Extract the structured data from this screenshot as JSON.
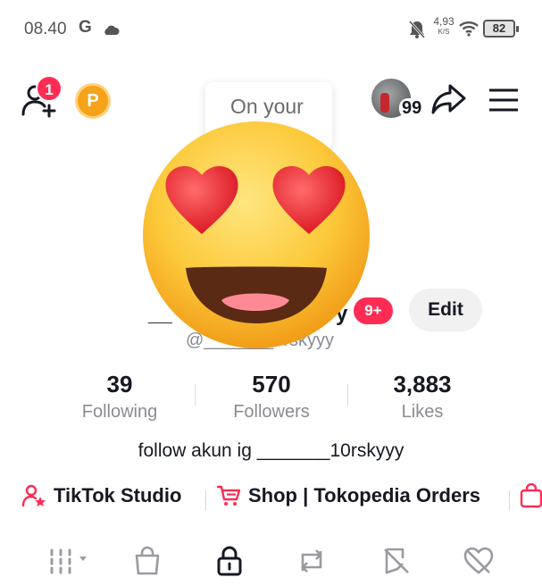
{
  "status_bar": {
    "time": "08.40",
    "carrier_glyph": "G",
    "icons": [
      "cloud-icon",
      "bell-muted-icon",
      "wifi-icon",
      "battery-icon"
    ],
    "net_speed": "4,93",
    "net_speed_unit": "K/S",
    "battery": "82"
  },
  "header": {
    "add_friend_badge": "1",
    "coin_label": "P",
    "tooltip_text": "On your",
    "story_count": "99"
  },
  "profile": {
    "name_prefix": "__",
    "name_suffix": "y",
    "notification_badge": "9+",
    "edit_label": "Edit",
    "handle": "@_______0rskyyy",
    "bio": "follow akun ig _______10rskyyy"
  },
  "stats": [
    {
      "value": "39",
      "label": "Following"
    },
    {
      "value": "570",
      "label": "Followers"
    },
    {
      "value": "3,883",
      "label": "Likes"
    }
  ],
  "links": {
    "studio": "TikTok Studio",
    "shop": "Shop | Tokopedia Orders"
  },
  "tabs": [
    "grid-icon",
    "shopping-bag-icon",
    "lock-icon",
    "repost-icon",
    "favorites-icon",
    "liked-icon"
  ],
  "colors": {
    "accent": "#fe2c55",
    "text": "#161823",
    "secondary_text": "#8a8b91",
    "coin": "#f6a21b"
  }
}
